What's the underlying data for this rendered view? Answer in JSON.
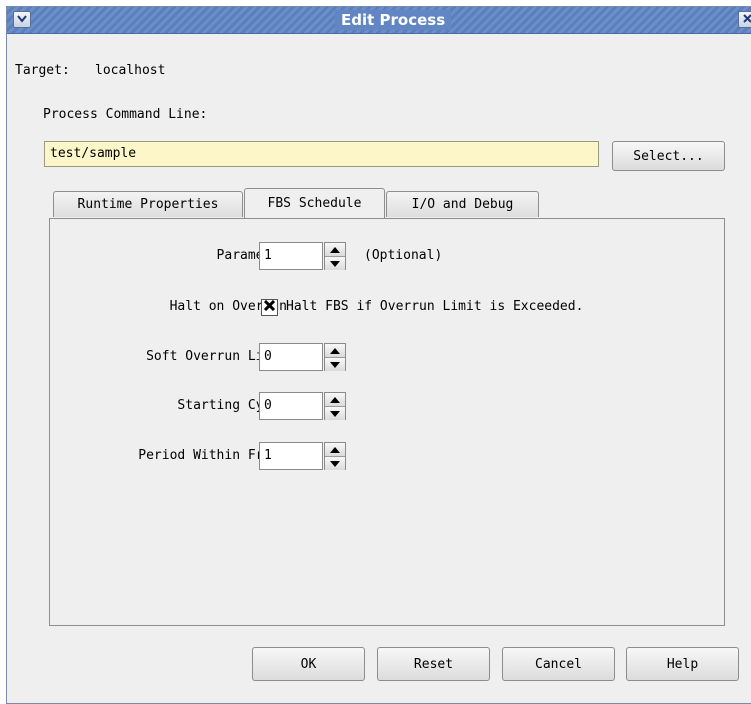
{
  "window": {
    "title": "Edit Process",
    "menu_icon": "chevron-down-icon",
    "close_icon": "close-icon"
  },
  "target": {
    "label": "Target:",
    "value": "localhost"
  },
  "command": {
    "label": "Process Command Line:",
    "value": "test/sample",
    "select_label": "Select..."
  },
  "tabs": [
    {
      "label": "Runtime Properties",
      "active": false
    },
    {
      "label": "FBS Schedule",
      "active": true
    },
    {
      "label": "I/O and Debug",
      "active": false
    }
  ],
  "fbs": {
    "parameter": {
      "label": "Parameter",
      "value": "1",
      "hint": "(Optional)"
    },
    "halt": {
      "label": "Halt on Overrun",
      "checked": true,
      "checkbox_label": "Halt FBS if Overrun Limit is Exceeded."
    },
    "soft_overrun": {
      "label": "Soft Overrun Limit",
      "value": "0"
    },
    "starting_cycle": {
      "label": "Starting Cycle",
      "value": "0"
    },
    "period": {
      "label": "Period Within Frame",
      "value": "1"
    }
  },
  "buttons": {
    "ok": "OK",
    "reset": "Reset",
    "cancel": "Cancel",
    "help": "Help"
  },
  "colors": {
    "titlebar": "#6286c4",
    "command_field_bg": "#fdf6c9",
    "window_bg": "#efefef"
  }
}
